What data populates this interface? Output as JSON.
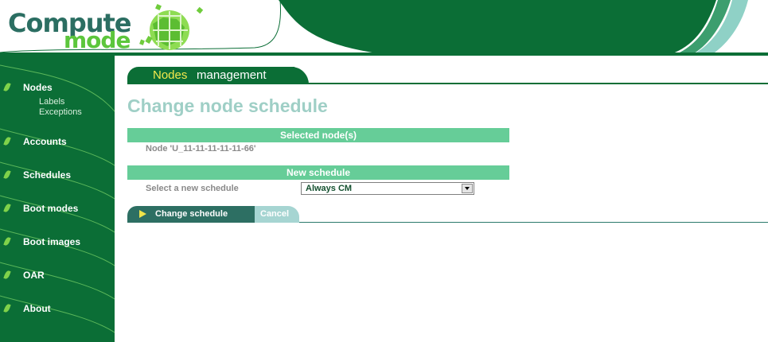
{
  "logo": {
    "line1": "Compute",
    "line2": "mode"
  },
  "sidebar": {
    "items": [
      {
        "label": "Nodes"
      },
      {
        "label": "Accounts"
      },
      {
        "label": "Schedules"
      },
      {
        "label": "Boot modes"
      },
      {
        "label": "Boot images"
      },
      {
        "label": "OAR"
      },
      {
        "label": "About"
      }
    ],
    "subitems": [
      {
        "label": "Labels"
      },
      {
        "label": "Exceptions"
      }
    ]
  },
  "section": {
    "highlight": "Nodes",
    "rest": "management"
  },
  "page": {
    "title": "Change node schedule"
  },
  "selected_nodes": {
    "header": "Selected node(s)",
    "node": "Node 'U_11-11-11-11-11-66'"
  },
  "new_schedule": {
    "header": "New schedule",
    "label": "Select a new schedule",
    "selected": "Always CM"
  },
  "buttons": {
    "change": "Change schedule",
    "cancel": "Cancel"
  },
  "colors": {
    "dark_green": "#0b6e36",
    "teal_panel": "#66cd98",
    "title": "#9fcfc6"
  }
}
